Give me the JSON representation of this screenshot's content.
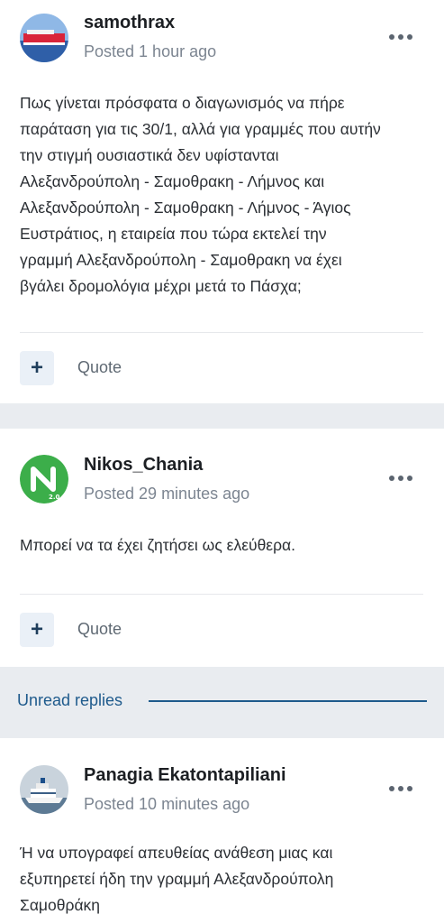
{
  "posts": [
    {
      "author": "samothrax",
      "posted": "Posted 1 hour ago",
      "avatar_icon": "ferry-photo-icon",
      "body": "Πως γίνεται πρόσφατα ο διαγωνισμός να πήρε παράταση για τις 30/1, αλλά για γραμμές που αυτήν την στιγμή ουσιαστικά δεν υφίστανται Αλεξανδρούπολη - Σαμοθρακη - Λήμνος και Αλεξανδρούπολη - Σαμοθρακη - Λήμνος - Άγιος Ευστράτιος, η εταιρεία που τώρα εκτελεί την γραμμή Αλεξανδρούπολη - Σαμοθρακη να έχει βγάλει δρομολόγια μέχρι μετά το Πάσχα;",
      "body_lines": [
        "Πως γίνεται πρόσφατα ο διαγωνισμός να πήρε",
        "παράταση για τις 30/1, αλλά για γραμμές που αυτήν",
        "την στιγμή ουσιαστικά δεν υφίστανται",
        "Αλεξανδρούπολη - Σαμοθρακη - Λήμνος και",
        "Αλεξανδρούπολη - Σαμοθρακη - Λήμνος - Άγιος",
        "Ευστράτιος, η εταιρεία που τώρα εκτελεί την",
        "γραμμή Αλεξανδρούπολη - Σαμοθρακη να έχει",
        "βγάλει δρομολόγια μέχρι μετά το Πάσχα;"
      ],
      "plus_label": "+",
      "quote_label": "Quote"
    },
    {
      "author": "Nikos_Chania",
      "posted": "Posted 29 minutes ago",
      "avatar_icon": "green-n-logo-icon",
      "avatar_badge": "2.0",
      "body_lines": [
        "Μπορεί να τα έχει ζητήσει ως ελεύθερα."
      ],
      "plus_label": "+",
      "quote_label": "Quote"
    },
    {
      "author": "Panagia Ekatontapiliani",
      "posted": "Posted 10 minutes ago",
      "avatar_icon": "ship-photo-icon",
      "body_lines": [
        "Ή να υπογραφεί απευθείας ανάθεση μιας και",
        "εξυπηρετεί ήδη την γραμμή Αλεξανδρούπολη",
        "Σαμοθράκη"
      ]
    }
  ],
  "unread": {
    "label": "Unread replies"
  },
  "colors": {
    "background": "#e9ecf0",
    "accent": "#1e5a8c",
    "meta_text": "#7c8591",
    "avatar_green": "#3cae4a"
  }
}
